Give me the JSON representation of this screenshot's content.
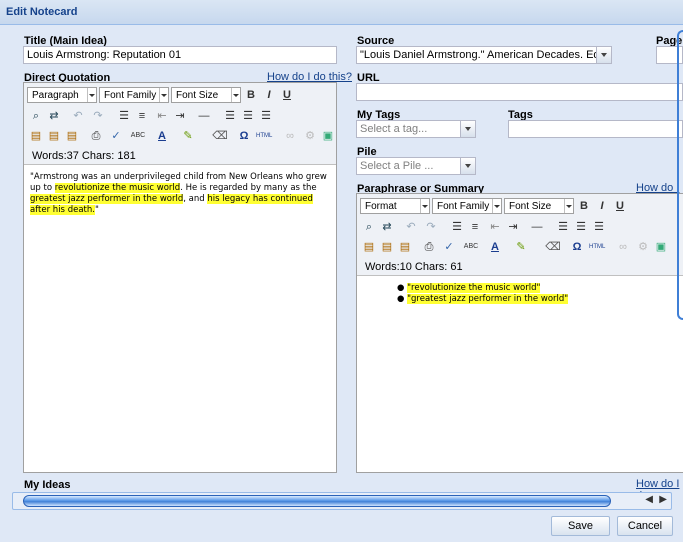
{
  "window": {
    "title": "Edit Notecard"
  },
  "title_field": {
    "label": "Title (Main Idea)",
    "value": "Louis Armstrong: Reputation 01"
  },
  "source": {
    "label": "Source",
    "value": "\"Louis Daniel Armstrong.\" American Decades. Ed. Judith"
  },
  "page": {
    "label": "Page"
  },
  "url": {
    "label": "URL",
    "value": ""
  },
  "my_tags": {
    "label": "My Tags",
    "placeholder": "Select a tag..."
  },
  "tags": {
    "label": "Tags",
    "value": ""
  },
  "pile": {
    "label": "Pile",
    "placeholder": "Select a Pile ..."
  },
  "direct_quotation": {
    "label": "Direct Quotation",
    "help": "How do I do this?",
    "format_select": "Paragraph",
    "font_family": "Font Family",
    "font_size": "Font Size",
    "counts": "Words:37 Chars: 181",
    "text": {
      "p1": "\"Armstrong was an underprivileged child from New Orleans who grew up to ",
      "h1": "revolutionize the music world",
      "p2": ". He is regarded by many as the ",
      "h2": "greatest jazz performer in the world",
      "p3": ", and ",
      "h3": "his legacy has continued after his death.",
      "p4": "\""
    }
  },
  "paraphrase": {
    "label": "Paraphrase or Summary",
    "help": "How do I d",
    "format_select": "Format",
    "font_family": "Font Family",
    "font_size": "Font Size",
    "counts": "Words:10 Chars: 61",
    "bullets": [
      "\"revolutionize the music world\"",
      "\"greatest jazz performer in the world\""
    ]
  },
  "my_ideas": {
    "label": "My Ideas",
    "help": "How do I d"
  },
  "buttons": {
    "save": "Save",
    "cancel": "Cancel"
  },
  "toolbar_icons": {
    "bold": "B",
    "italic": "I",
    "underline": "U",
    "omega": "Ω",
    "html": "HTML",
    "abc": "ABC",
    "font_color": "A"
  }
}
